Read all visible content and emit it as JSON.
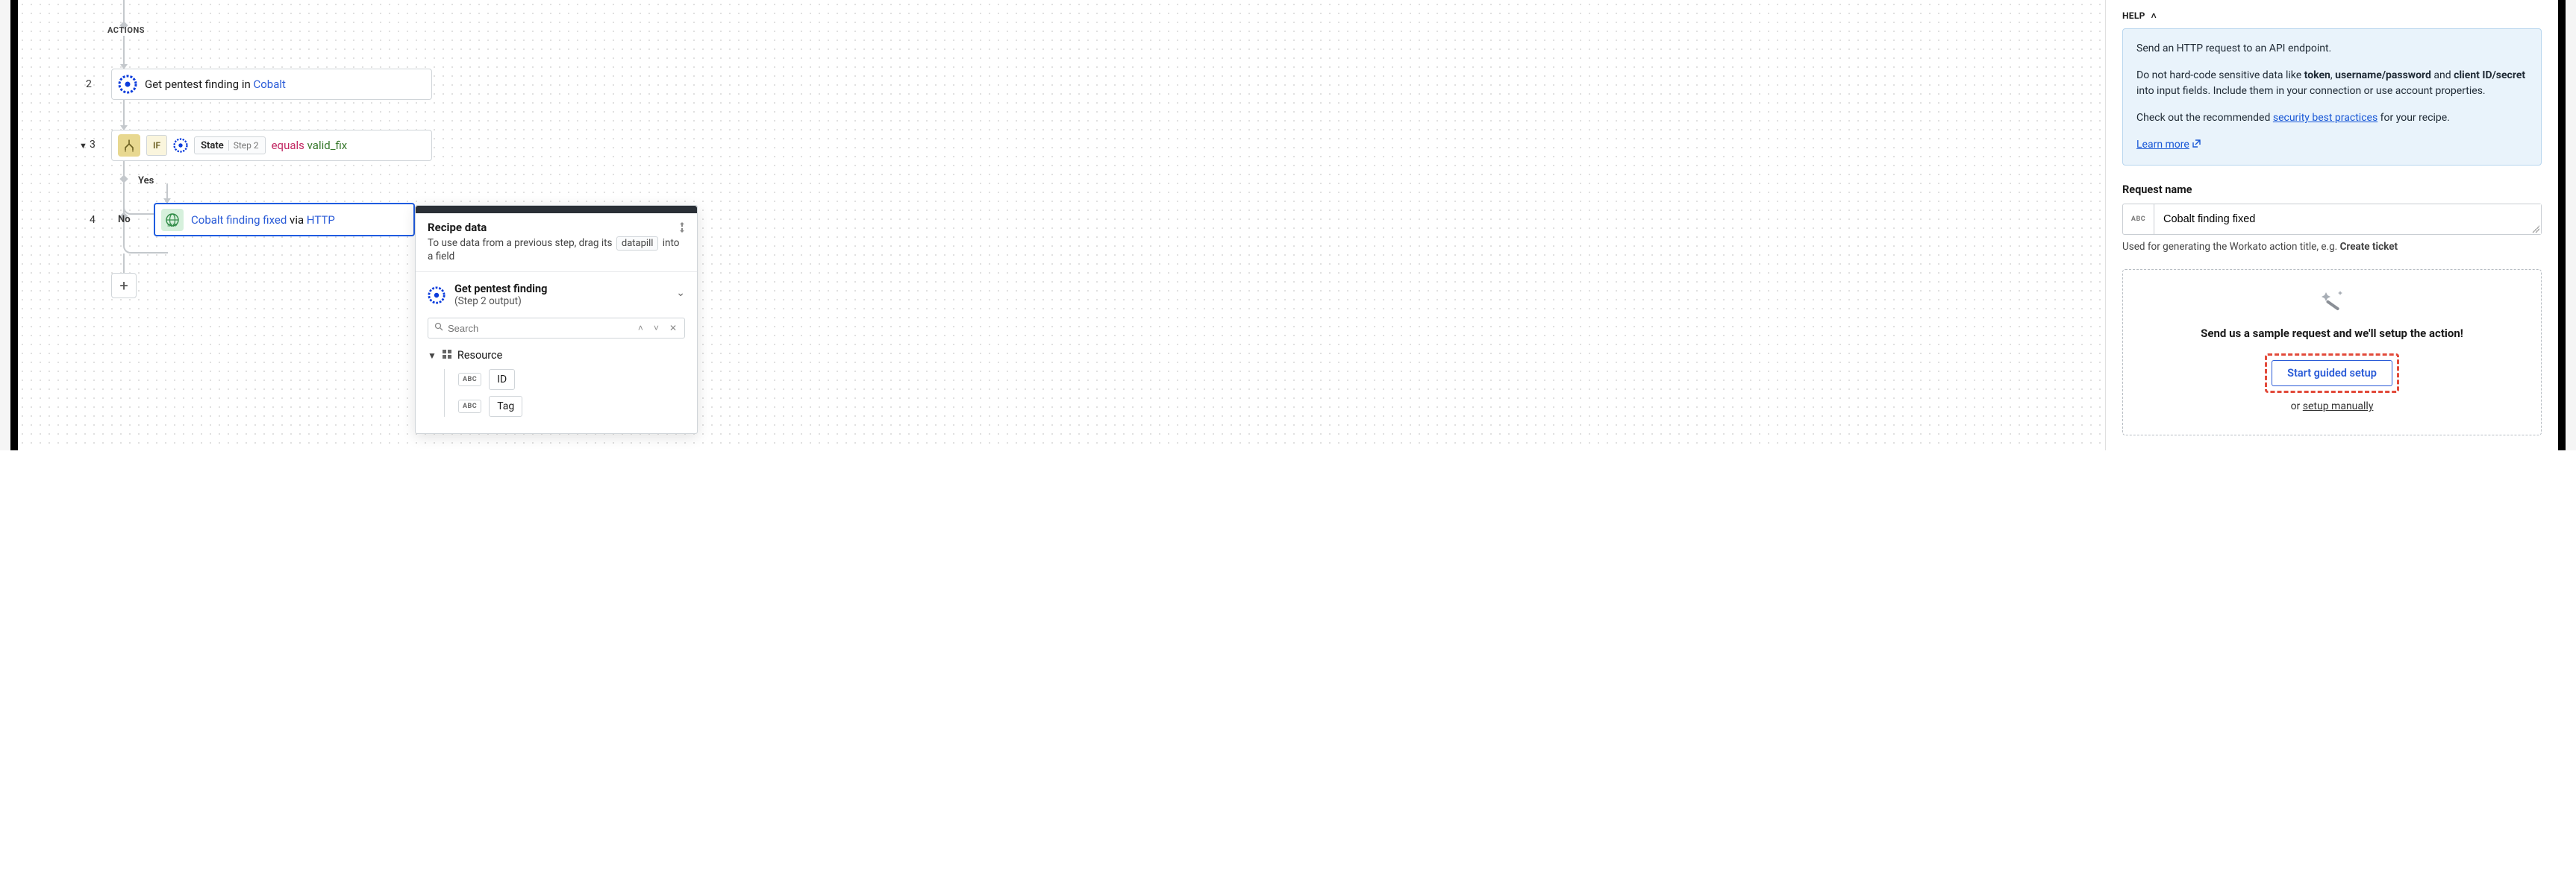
{
  "flow": {
    "actions_label": "ACTIONS",
    "step2_num": "2",
    "step2_prefix": "Get pentest finding in ",
    "step2_app": "Cobalt",
    "step3_num": "3",
    "if_chip": "IF",
    "state_key": "State",
    "state_step": "Step 2",
    "equals": "equals",
    "equals_value": "valid_fix",
    "yes": "Yes",
    "no": "No",
    "step4_num": "4",
    "step4_title": "Cobalt finding fixed",
    "step4_via": " via ",
    "step4_proto": "HTTP",
    "plus": "+"
  },
  "popover": {
    "title": "Recipe data",
    "sub_pre": "To use data from a previous step, drag its ",
    "sub_chip": "datapill",
    "sub_post": " into a field",
    "output_title": "Get pentest finding",
    "output_sub": "(Step 2 output)",
    "search_placeholder": "Search",
    "resource_label": "Resource",
    "abc": "ABC",
    "field_id": "ID",
    "field_tag": "Tag"
  },
  "help": {
    "header": "HELP",
    "p1": "Send an HTTP request to an API endpoint.",
    "p2_pre": "Do not hard-code sensitive data like ",
    "token": "token",
    "comma1": ", ",
    "userpass": "username/password",
    "and": " and ",
    "clientid": "client ID/secret",
    "p2_post": " into input fields. Include them in your connection or use account properties.",
    "p3_pre": "Check out the recommended ",
    "p3_link": "security best practices",
    "p3_post": " for your recipe.",
    "learn": "Learn more"
  },
  "request": {
    "label": "Request name",
    "prefix": "ABC",
    "value": "Cobalt finding fixed",
    "hint_pre": "Used for generating the Workato action title, e.g. ",
    "hint_bold": "Create ticket"
  },
  "setup": {
    "text": "Send us a sample request and we'll setup the action!",
    "button": "Start guided setup",
    "or_pre": "or ",
    "or_link": "setup manually"
  }
}
